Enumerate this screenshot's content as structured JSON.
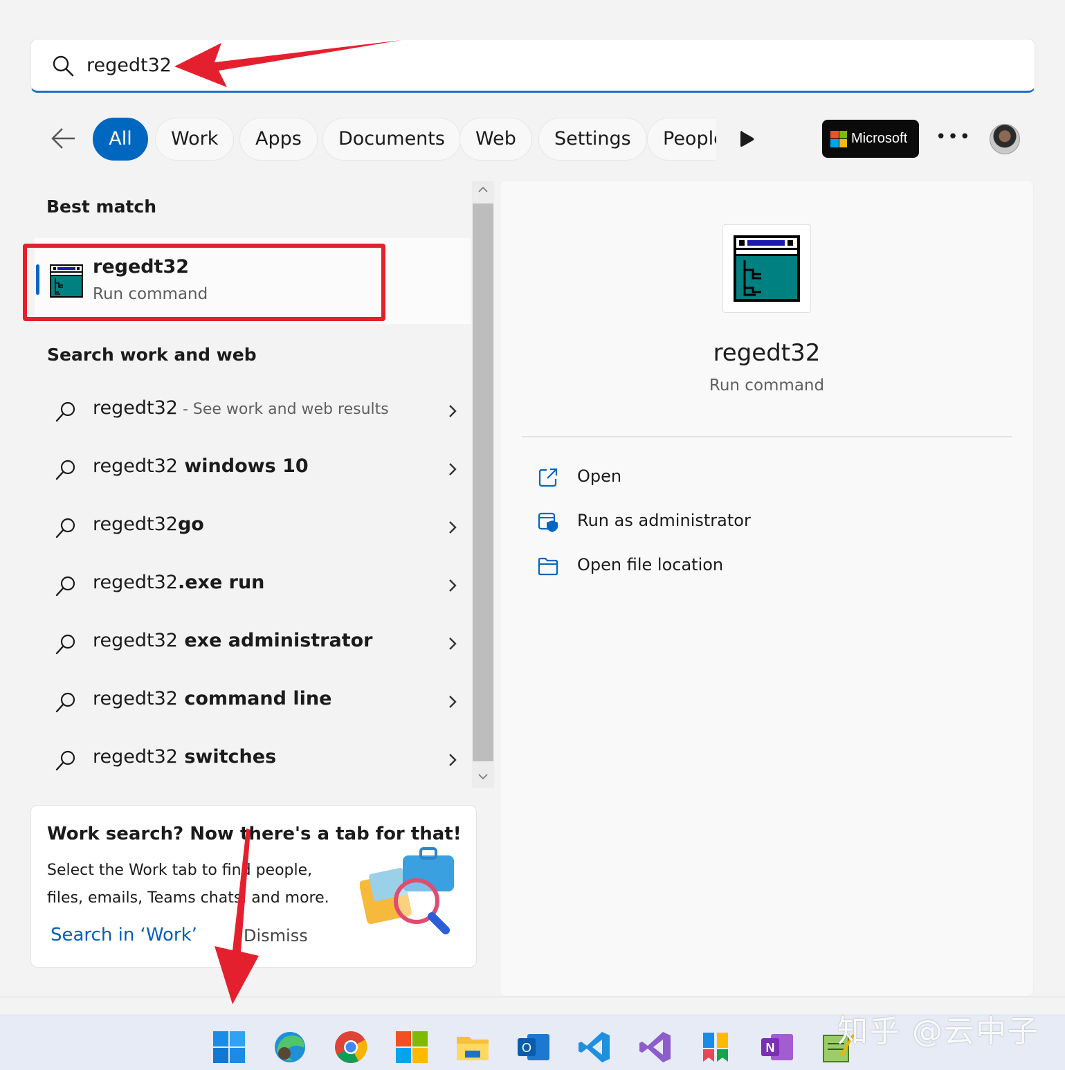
{
  "search": {
    "query": "regedt32"
  },
  "filters": {
    "tabs": [
      {
        "label": "All",
        "active": true
      },
      {
        "label": "Work"
      },
      {
        "label": "Apps"
      },
      {
        "label": "Documents"
      },
      {
        "label": "Web"
      },
      {
        "label": "Settings"
      },
      {
        "label": "People"
      }
    ],
    "brand_label": "Microsoft"
  },
  "best_match": {
    "heading": "Best match",
    "name": "regedt32",
    "type": "Run command"
  },
  "web_section": {
    "heading": "Search work and web",
    "items": [
      {
        "prefix": "regedt32",
        "bold": "",
        "hint": " - See work and web results"
      },
      {
        "prefix": "regedt32",
        "bold": " windows 10",
        "hint": ""
      },
      {
        "prefix": "regedt32",
        "bold": "go",
        "hint": ""
      },
      {
        "prefix": "regedt32",
        "bold": ".exe run",
        "hint": ""
      },
      {
        "prefix": "regedt32",
        "bold": " exe administrator",
        "hint": ""
      },
      {
        "prefix": "regedt32",
        "bold": " command line",
        "hint": ""
      },
      {
        "prefix": "regedt32",
        "bold": " switches",
        "hint": ""
      }
    ]
  },
  "promo": {
    "title": "Work search? Now there's a tab for that!",
    "body": "Select the Work tab to find people, files, emails, Teams chats, and more.",
    "link": "Search in ‘Work’",
    "dismiss": "Dismiss"
  },
  "details": {
    "name": "regedt32",
    "type": "Run command",
    "actions": [
      {
        "label": "Open",
        "icon": "open-external-icon"
      },
      {
        "label": "Run as administrator",
        "icon": "shield-admin-icon"
      },
      {
        "label": "Open file location",
        "icon": "folder-icon"
      }
    ]
  },
  "taskbar": {
    "icons": [
      "windows-start-icon",
      "edge-icon",
      "chrome-icon",
      "microsoft-store-icon",
      "file-explorer-icon",
      "outlook-icon",
      "vscode-icon",
      "visual-studio-icon",
      "app-icon",
      "onenote-icon",
      "notepad-icon"
    ]
  },
  "watermark": "知乎 @云中子",
  "colors": {
    "accent": "#0067c0",
    "annotation_red": "#e5202e",
    "regedit_teal": "#008080"
  }
}
